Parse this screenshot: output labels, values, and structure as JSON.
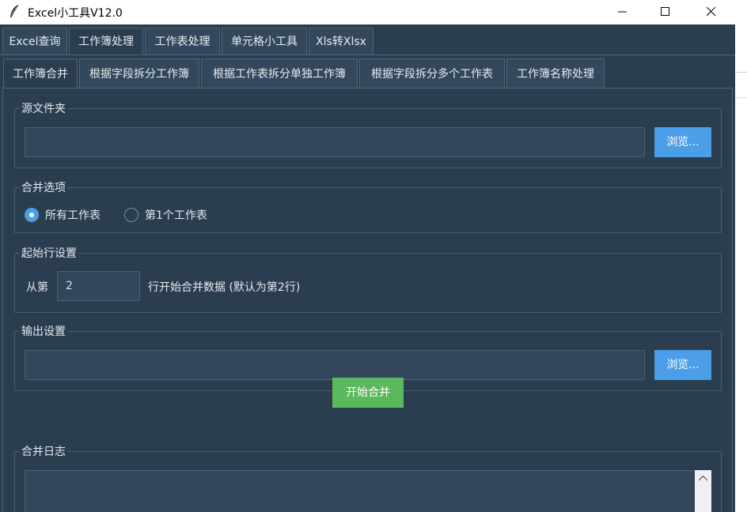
{
  "window": {
    "title": "Excel小工具V12.0"
  },
  "main_tabs": [
    {
      "label": "Excel查询",
      "active": false
    },
    {
      "label": "工作簿处理",
      "active": true
    },
    {
      "label": "工作表处理",
      "active": false
    },
    {
      "label": "单元格小工具",
      "active": false
    },
    {
      "label": "Xls转Xlsx",
      "active": false
    }
  ],
  "sub_tabs": [
    {
      "label": "工作簿合并",
      "active": true
    },
    {
      "label": "根据字段拆分工作簿",
      "active": false
    },
    {
      "label": "根据工作表拆分单独工作簿",
      "active": false
    },
    {
      "label": "根据字段拆分多个工作表",
      "active": false
    },
    {
      "label": "工作簿名称处理",
      "active": false
    }
  ],
  "source_folder": {
    "label": "源文件夹",
    "path_value": "",
    "browse_label": "浏览..."
  },
  "merge_options": {
    "label": "合并选项",
    "options": [
      {
        "label": "所有工作表",
        "checked": true
      },
      {
        "label": "第1个工作表",
        "checked": false
      }
    ]
  },
  "start_row": {
    "label": "起始行设置",
    "prefix": "从第",
    "value": "2",
    "suffix": "行开始合并数据 (默认为第2行)"
  },
  "output": {
    "label": "输出设置",
    "path_value": "",
    "browse_label": "浏览..."
  },
  "actions": {
    "start_label": "开始合并"
  },
  "log": {
    "label": "合并日志",
    "content": ""
  },
  "colors": {
    "background": "#2b3e50",
    "accent": "#4b9ee8",
    "start_button": "#5cb85c"
  }
}
